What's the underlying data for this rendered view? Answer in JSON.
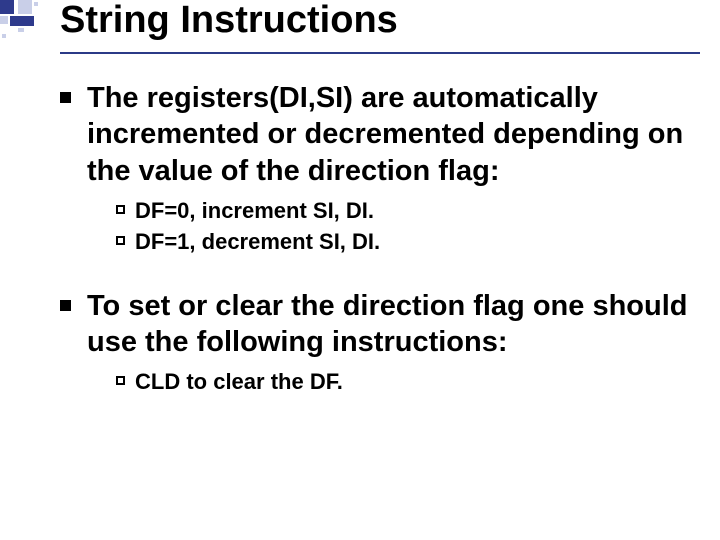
{
  "title": "String Instructions",
  "bullets": [
    {
      "text": "The registers(DI,SI) are automatically incremented or decremented depending on the value of the direction flag:",
      "subs": [
        {
          "lead": "DF=0,",
          "rest": " increment SI, DI."
        },
        {
          "lead": "DF=1,",
          "rest": " decrement SI, DI."
        }
      ]
    },
    {
      "text": "To set or clear the direction flag one should use the following instructions:",
      "subs": [
        {
          "lead": "CLD",
          "rest": " to clear the DF."
        }
      ]
    }
  ]
}
